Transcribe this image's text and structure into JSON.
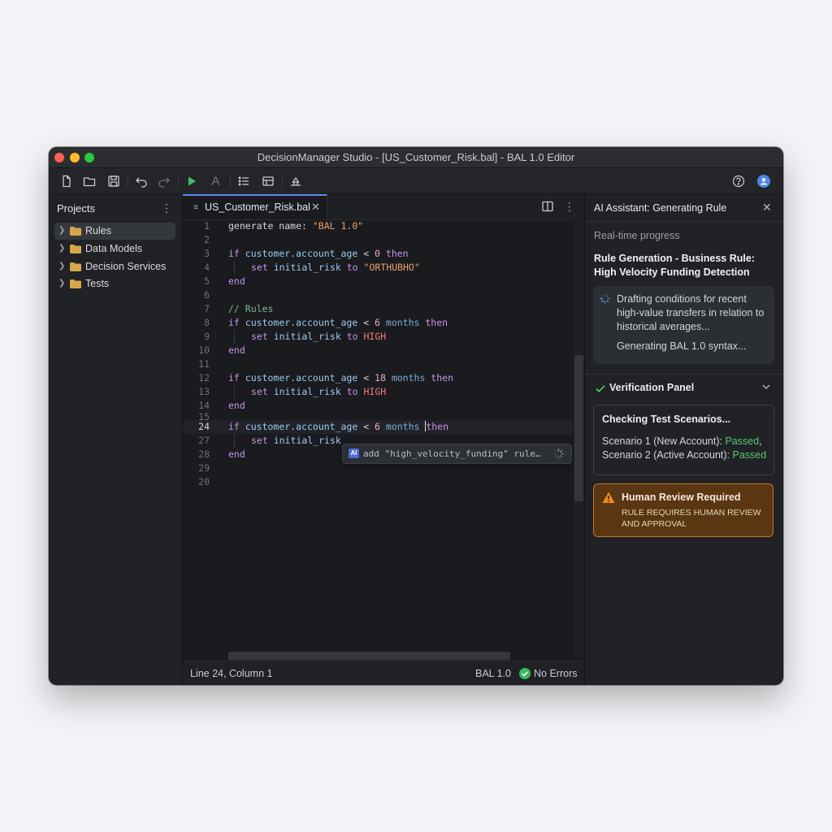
{
  "window": {
    "title": "DecisionManager Studio - [US_Customer_Risk.bal] - BAL 1.0 Editor"
  },
  "toolbar": {
    "icons": [
      "new-file-icon",
      "open-folder-icon",
      "save-icon",
      "undo-icon",
      "redo-icon",
      "run-icon",
      "format-icon",
      "list-icon",
      "table-icon",
      "deploy-icon",
      "help-icon",
      "account-icon"
    ]
  },
  "projects": {
    "title": "Projects",
    "items": [
      {
        "label": "Rules",
        "selected": true
      },
      {
        "label": "Data Models",
        "selected": false
      },
      {
        "label": "Decision Services",
        "selected": false
      },
      {
        "label": "Tests",
        "selected": false
      }
    ]
  },
  "editor": {
    "tab_label": "US_Customer_Risk.bal",
    "lines": [
      {
        "n": "1"
      },
      {
        "n": "2"
      },
      {
        "n": "3"
      },
      {
        "n": "4"
      },
      {
        "n": "5"
      },
      {
        "n": "6"
      },
      {
        "n": "7"
      },
      {
        "n": "8"
      },
      {
        "n": "9"
      },
      {
        "n": "10"
      },
      {
        "n": "11"
      },
      {
        "n": "12"
      },
      {
        "n": "13"
      },
      {
        "n": "14"
      },
      {
        "n": "15"
      },
      {
        "n": "24"
      },
      {
        "n": "27"
      },
      {
        "n": "28"
      },
      {
        "n": "29"
      },
      {
        "n": "20"
      }
    ],
    "code": {
      "l1_a": "generate name: ",
      "l1_b": "\"BAL 1.0\"",
      "l3_kw": "if",
      "l3_id": " customer.account_age ",
      "l3_op": "< ",
      "l3_num": "0",
      "l3_kw2": " then",
      "l4_kw": "set",
      "l4_id": " initial_risk ",
      "l4_kw2": "to",
      "l4_str": " \"ORTHUBHO\"",
      "l5": "end",
      "l7": "// Rules",
      "l8_kw": "if",
      "l8_id": " customer.account_age ",
      "l8_op": "< ",
      "l8_num": "6",
      "l8_unit": " months",
      "l8_kw2": " then",
      "l9_kw": "set",
      "l9_id": " initial_risk ",
      "l9_kw2": "to",
      "l9_val": " HIGH",
      "l10": "end",
      "l12_kw": "if",
      "l12_id": " customer.account_age ",
      "l12_op": "< ",
      "l12_num": "18",
      "l12_unit": " months",
      "l12_kw2": " then",
      "l13_kw": "set",
      "l13_id": " initial_risk ",
      "l13_kw2": "to",
      "l13_val": " HIGH",
      "l14": "end",
      "l24_kw": "if",
      "l24_id": " customer.account_age ",
      "l24_op": "< ",
      "l24_num": "6",
      "l24_unit": " months ",
      "l24_kw2": "then",
      "l27_kw": "set",
      "l27_id": " initial_risk",
      "l28": "end"
    },
    "suggestion": {
      "badge": "AI",
      "text": "add \"high_velocity_funding\" rule…"
    }
  },
  "status": {
    "position": "Line 24, Column 1",
    "language": "BAL 1.0",
    "errors": "No Errors"
  },
  "assistant": {
    "title": "AI Assistant: Generating Rule",
    "subtitle": "Real-time progress",
    "heading": "Rule Generation - Business Rule: High Velocity Funding Detection",
    "progress_text": "Drafting conditions for recent high-value transfers in relation to historical averages...",
    "progress_text2": "Generating BAL 1.0 syntax...",
    "verification": {
      "title": "Verification Panel",
      "card_heading": "Checking Test Scenarios...",
      "scenario1": "Scenario 1 (New Account): ",
      "scenario1_status": "Passed",
      "scenario1_suffix": ",",
      "scenario2": "Scenario 2 (Active Account): ",
      "scenario2_status": "Passed"
    },
    "review": {
      "title": "Human Review Required",
      "body": "RULE REQUIRES HUMAN REVIEW AND APPROVAL"
    }
  },
  "colors": {
    "accent": "#5a8dee",
    "pass": "#58c76b",
    "warning": "#c9781f"
  }
}
